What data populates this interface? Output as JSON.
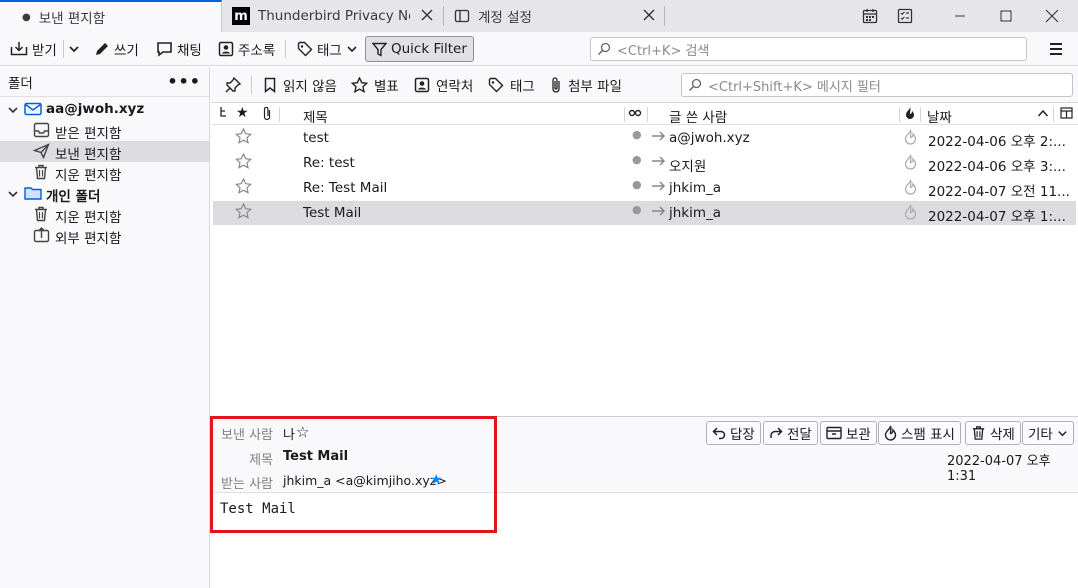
{
  "tabs": [
    {
      "label": "보낸 편지함"
    },
    {
      "label": "Thunderbird Privacy Notice"
    },
    {
      "label": "계정 설정"
    }
  ],
  "toolbar": {
    "get_messages": "받기",
    "write": "쓰기",
    "chat": "채팅",
    "address_book": "주소록",
    "tag": "태그",
    "quick_filter": "Quick Filter",
    "search_placeholder": "<Ctrl+K> 검색"
  },
  "folder_pane": {
    "title": "폴더",
    "account": "aa@jwoh.xyz",
    "account_folders": [
      "받은 편지함",
      "보낸 편지함",
      "지운 편지함"
    ],
    "local": "개인 폴더",
    "local_folders": [
      "지운 편지함",
      "외부 편지함"
    ]
  },
  "quick_filter_bar": {
    "unread": "읽지 않음",
    "starred": "별표",
    "contact": "연락처",
    "tags": "태그",
    "attachment": "첨부 파일",
    "filter_placeholder": "<Ctrl+Shift+K> 메시지 필터"
  },
  "thread_columns": {
    "subject": "제목",
    "recipient": "글 쓴 사람",
    "date": "날짜"
  },
  "messages": [
    {
      "subject": "test",
      "recipient": "a@jwoh.xyz",
      "date": "2022-04-06 오후 2:..."
    },
    {
      "subject": "Re: test",
      "recipient": "오지원",
      "date": "2022-04-06 오후 3:..."
    },
    {
      "subject": "Re: Test Mail",
      "recipient": "jhkim_a",
      "date": "2022-04-07 오전 11..."
    },
    {
      "subject": "Test Mail",
      "recipient": "jhkim_a",
      "date": "2022-04-07 오후 1:..."
    }
  ],
  "message_header": {
    "from_label": "보낸 사람",
    "from_value": "나",
    "subject_label": "제목",
    "subject_value": "Test Mail",
    "to_label": "받는 사람",
    "to_value": "jhkim_a <a@kimjiho.xyz>",
    "date": "2022-04-07 오후 1:31",
    "actions": {
      "reply": "답장",
      "forward": "전달",
      "archive": "보관",
      "junk": "스팸 표시",
      "delete": "삭제",
      "more": "기타"
    }
  },
  "message_body": "Test Mail",
  "colors": {
    "accent": "#0060df",
    "highlight": "#e3141b",
    "star_blue": "#0a84ff"
  }
}
